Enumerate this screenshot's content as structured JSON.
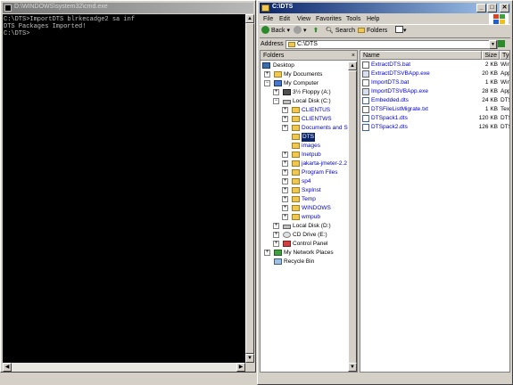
{
  "cmd": {
    "title": "D:\\WINDOWS\\system32\\cmd.exe",
    "lines": [
      "C:\\DTS>ImportDTS blrkecadge2 sa inf",
      "DTS Packages Imported!",
      "",
      "C:\\DTS>"
    ]
  },
  "explorer": {
    "title": "C:\\DTS",
    "menu": [
      "File",
      "Edit",
      "View",
      "Favorites",
      "Tools",
      "Help"
    ],
    "toolbar": {
      "back": "Back",
      "search": "Search",
      "folders": "Folders"
    },
    "address": {
      "label": "Address",
      "value": "C:\\DTS",
      "go": "Go"
    },
    "folders_pane": {
      "header": "Folders",
      "close": "×",
      "tree": [
        {
          "label": "Desktop",
          "icon": "desktop-icon"
        },
        {
          "label": "My Documents",
          "icon": "folder-icon"
        },
        {
          "label": "My Computer",
          "icon": "computer-icon"
        },
        {
          "label": "3½ Floppy (A:)",
          "icon": "floppy-icon"
        },
        {
          "label": "Local Disk (C:)",
          "icon": "drive-icon"
        },
        {
          "label": "CLIENTUS",
          "icon": "folder-icon"
        },
        {
          "label": "CLIENTWS",
          "icon": "folder-icon"
        },
        {
          "label": "Documents and Settings",
          "icon": "folder-icon"
        },
        {
          "label": "DTS",
          "icon": "folder-icon"
        },
        {
          "label": "images",
          "icon": "folder-icon"
        },
        {
          "label": "Inetpub",
          "icon": "folder-icon"
        },
        {
          "label": "jakarta-jmeter-2.2",
          "icon": "folder-icon"
        },
        {
          "label": "Program Files",
          "icon": "folder-icon"
        },
        {
          "label": "sp4",
          "icon": "folder-icon"
        },
        {
          "label": "SxpInst",
          "icon": "folder-icon"
        },
        {
          "label": "Temp",
          "icon": "folder-icon"
        },
        {
          "label": "WINDOWS",
          "icon": "folder-icon"
        },
        {
          "label": "wmpub",
          "icon": "folder-icon"
        },
        {
          "label": "Local Disk (D:)",
          "icon": "drive-icon"
        },
        {
          "label": "CD Drive (E:)",
          "icon": "cd-icon"
        },
        {
          "label": "Control Panel",
          "icon": "control-panel-icon"
        },
        {
          "label": "My Network Places",
          "icon": "network-icon"
        },
        {
          "label": "Recycle Bin",
          "icon": "recycle-bin-icon"
        }
      ]
    },
    "files": {
      "columns": [
        "Name",
        "Size",
        "Typ"
      ],
      "rows": [
        {
          "name": "ExtractDTS.bat",
          "size": "2 KB",
          "type": "Wind"
        },
        {
          "name": "ExtractDTSVBApp.exe",
          "size": "20 KB",
          "type": "App"
        },
        {
          "name": "ImportDTS.bat",
          "size": "1 KB",
          "type": "Wind"
        },
        {
          "name": "ImportDTSVBApp.exe",
          "size": "28 KB",
          "type": "App"
        },
        {
          "name": "Embedded.dts",
          "size": "24 KB",
          "type": "DTS"
        },
        {
          "name": "DTSFileListMigrate.txt",
          "size": "1 KB",
          "type": "Text"
        },
        {
          "name": "DTSpack1.dts",
          "size": "120 KB",
          "type": "DTS"
        },
        {
          "name": "DTSpack2.dts",
          "size": "126 KB",
          "type": "DTS"
        }
      ]
    }
  }
}
